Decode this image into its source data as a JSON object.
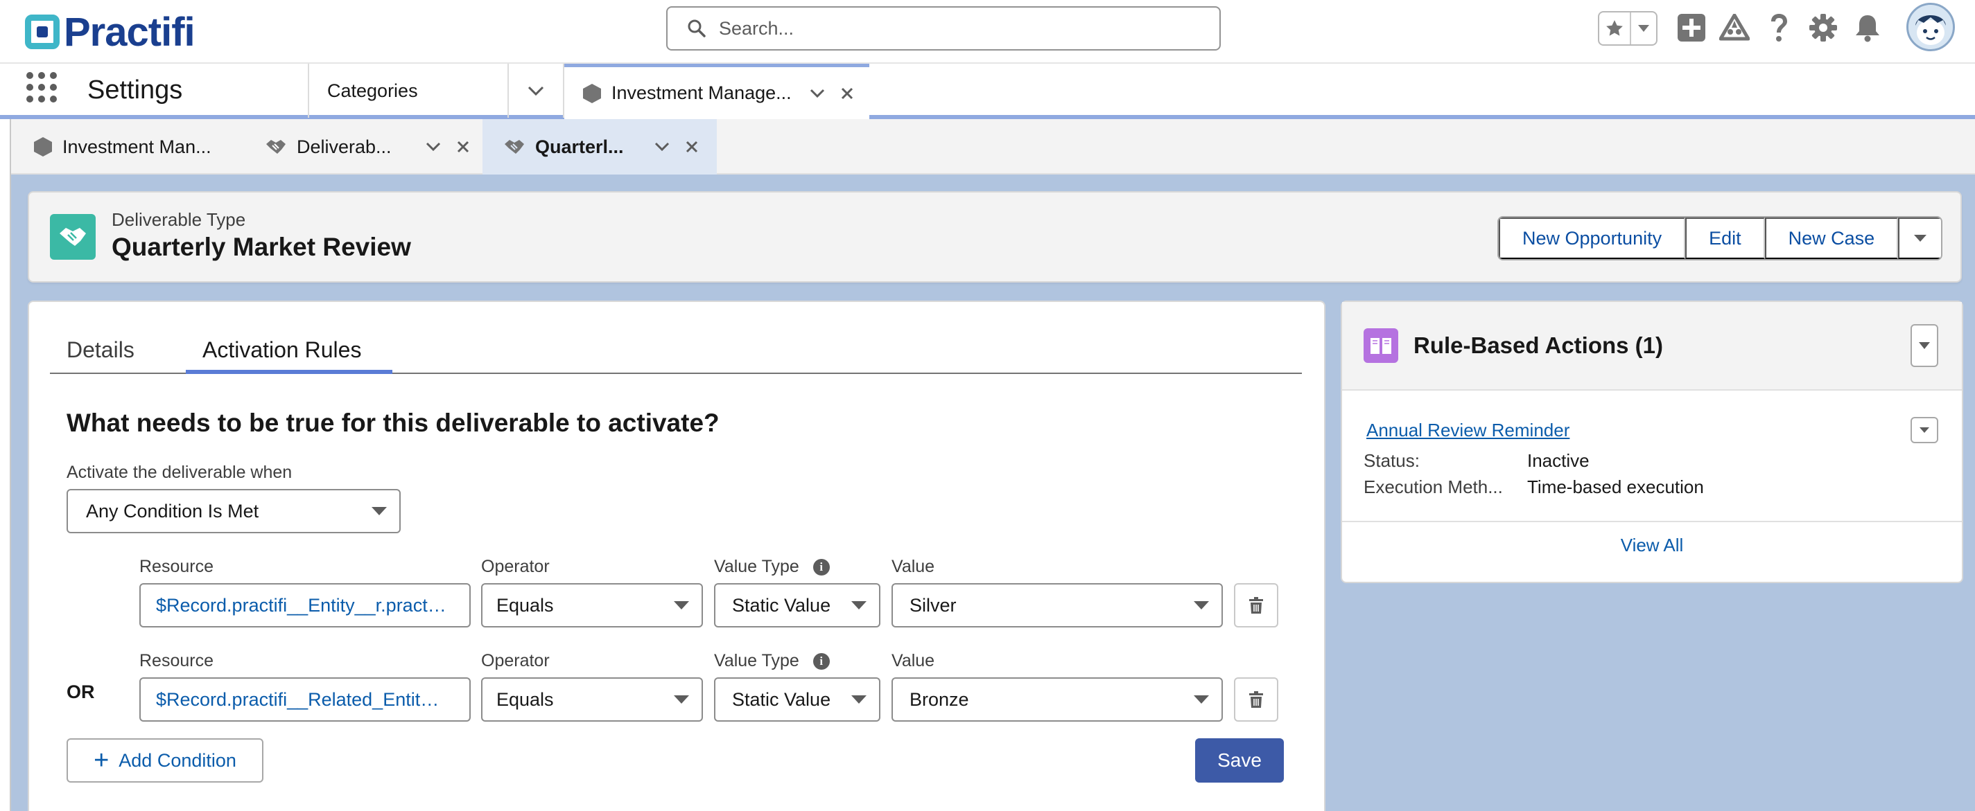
{
  "brand": {
    "name": "Practifi"
  },
  "search": {
    "placeholder": "Search..."
  },
  "header_icons": [
    "favorites-star-icon",
    "add-icon",
    "trailhead-icon",
    "help-icon",
    "setup-gear-icon",
    "notifications-bell-icon",
    "user-avatar"
  ],
  "app": {
    "name": "Settings"
  },
  "nav": {
    "categories_label": "Categories",
    "active_tab_label": "Investment Manage..."
  },
  "subtabs": [
    {
      "label": "Investment Man..."
    },
    {
      "label": "Deliverab..."
    },
    {
      "label": "Quarterl..."
    }
  ],
  "record": {
    "type_label": "Deliverable Type",
    "title": "Quarterly Market Review",
    "actions": [
      "New Opportunity",
      "Edit",
      "New Case"
    ]
  },
  "tabs": {
    "details": "Details",
    "activation": "Activation Rules"
  },
  "activation": {
    "question": "What needs to be true for this deliverable to activate?",
    "when_label": "Activate the deliverable when",
    "when_value": "Any Condition Is Met",
    "labels": {
      "resource": "Resource",
      "operator": "Operator",
      "value_type": "Value Type",
      "value": "Value"
    },
    "conditions": [
      {
        "connector": "",
        "resource": "$Record.practifi__Entity__r.practi...",
        "operator": "Equals",
        "value_type": "Static Value",
        "value": "Silver"
      },
      {
        "connector": "OR",
        "resource": "$Record.practifi__Related_Entity_...",
        "operator": "Equals",
        "value_type": "Static Value",
        "value": "Bronze"
      }
    ],
    "add_condition": "Add Condition",
    "save": "Save"
  },
  "rule_actions": {
    "title": "Rule-Based Actions (1)",
    "item": {
      "name": "Annual Review Reminder",
      "status_key": "Status:",
      "status_value": "Inactive",
      "exec_key": "Execution Meth...",
      "exec_value": "Time-based execution"
    },
    "view_all": "View All"
  },
  "colors": {
    "brand_blue": "#1a3f8f",
    "brand_teal": "#3fb6c8",
    "record_icon": "#3bb9a5",
    "action_icon": "#b572e0",
    "save_button": "#3d5aa7",
    "link": "#0b5cab",
    "active_tab_bar": "#5a7cd6"
  }
}
